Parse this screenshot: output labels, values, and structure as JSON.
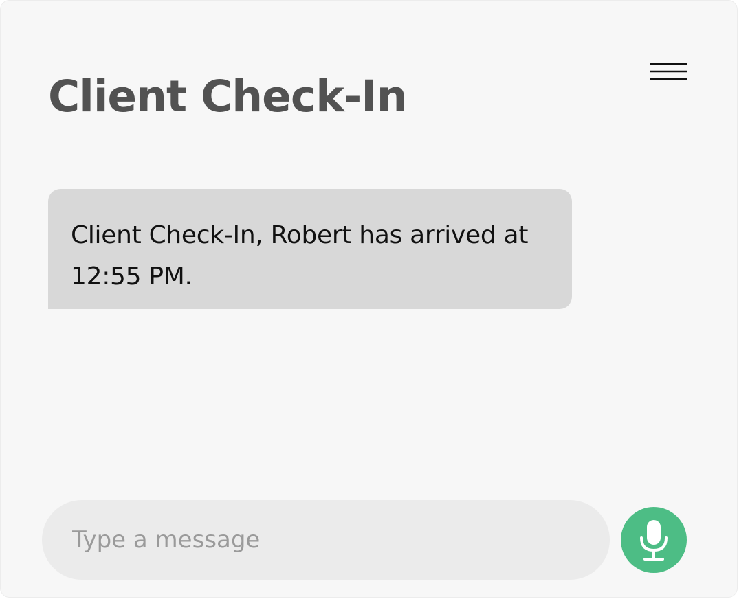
{
  "header": {
    "title": "Client Check-In",
    "menu_icon": "hamburger-menu-icon"
  },
  "messages": [
    {
      "text": "Client Check-In, Robert has arrived at 12:55 PM."
    }
  ],
  "composer": {
    "placeholder": "Type a message",
    "value": "",
    "mic_icon": "microphone-icon"
  },
  "colors": {
    "background": "#f7f7f7",
    "title": "#525252",
    "bubble": "#d8d8d8",
    "input": "#ebebeb",
    "accent": "#4dbd85"
  }
}
